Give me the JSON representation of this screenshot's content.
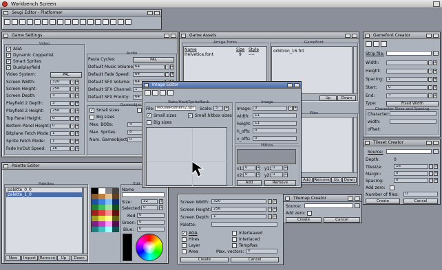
{
  "screen": {
    "title": "Workbench Screen"
  },
  "sevgi": {
    "title": "Sevgi Editor - Platformer"
  },
  "game_settings": {
    "title": "Game Settings",
    "video_group": "Video",
    "audio_group": "Audio",
    "gameobject_group": "Gameobject",
    "aga": "AGA",
    "dynamic_copperlist": "Dynamic Copperlist",
    "smart_sprites": "Smart Sprites",
    "dualplayfield": "Dualplayfield",
    "video_system_label": "Video System:",
    "video_system": "PAL",
    "screen_width_label": "Screen Width:",
    "screen_width": "320",
    "screen_height_label": "Screen Height:",
    "screen_height": "256",
    "screen_depth_label": "Screen Depth:",
    "screen_depth": "3",
    "pf2_depth_label": "Playfield 2 Depth:",
    "pf2_depth": "3",
    "pf2_height_label": "Playfield 2 Height:",
    "pf2_height": "256",
    "top_panel_label": "Top Panel Height:",
    "top_panel": "0",
    "bottom_panel_label": "Bottom Panel Height:",
    "bottom_panel": "0",
    "bitplane_label": "Bitplane Fetch Mode:",
    "bitplane": "1",
    "sprite_fetch_label": "Sprite Fetch Mode:",
    "sprite_fetch": "1",
    "fade_label": "Fade In/Out Speed:",
    "fade": "16",
    "paula_label": "Paula Cycles:",
    "paula": "PAL",
    "music_vol_label": "Default Music Volume:",
    "music_vol": "64",
    "fade_speed_label": "Default Fade Speed:",
    "fade_speed": "64",
    "sfx_vol_label": "Default SFX Volume:",
    "sfx_vol": "64",
    "sfx_chan_label": "Default SFX Channel:",
    "sfx_chan": "1",
    "sfx_prio_label": "Default SFX Priority:",
    "sfx_prio": "64",
    "small_sizes": "Small sizes",
    "big_sizes": "Big sizes",
    "sm": "Sm",
    "max_bobs_label": "Max. BOBs:",
    "max_bobs": "4",
    "max_sprites_label": "Max. Sprites:",
    "max_sprites": "8",
    "num_go_label": "Num. Gameobjects:",
    "num_go": "0"
  },
  "game_assets": {
    "title": "Game Assets",
    "amiga_fonts": "Amiga Fonts",
    "gamefonts": "GameFont",
    "name_col": "Name",
    "size_col": "Size",
    "style_col": "Style",
    "font_name": "Helvetica.font",
    "font_size": "9",
    "font_style": "----",
    "gamefont_item": "orbitron_16.fnt",
    "files": "Files",
    "add": "Add",
    "remove": "Remove",
    "up": "Up",
    "down": "Down"
  },
  "image_editor": {
    "title": "Image Editor",
    "bobs_group": "Bobs/Hwd/SpriteBank",
    "file_label": "File:",
    "file": "MousePointers2.spr",
    "scale_label": "Scale:",
    "scale": "5",
    "small_sizes": "Small sizes",
    "small_hitbox": "Small hitbox sizes",
    "big_sizes": "Big sizes",
    "image_group": "Image",
    "image_label": "Image:",
    "image": "0",
    "width_label": "width:",
    "width": "11",
    "height_label": "height:",
    "height": "11",
    "hoffs_label": "h_offs:",
    "hoffs": "0",
    "voffs_label": "v_offs:",
    "voffs": "0",
    "hitbox_group": "Hitbox",
    "x1_label": "x1:",
    "x1": "0",
    "y1_label": "y1:",
    "y1": "0",
    "x2_label": "x2:",
    "x2": "0",
    "y2_label": "y2:",
    "y2": "0",
    "add": "Add",
    "remove": "Remove"
  },
  "gamefont_creator": {
    "title": "Gamefont Creator",
    "strip_label": "Strip file:",
    "width_label": "Width:",
    "height_label": "Height:",
    "spacing_label": "Spacing:",
    "spacing": "1",
    "start_label": "Start:",
    "start": "0",
    "end_label": "End:",
    "end": "~",
    "type_label": "Type:",
    "type": "Fixed Width",
    "char_group": "Character Sizes and Spacing",
    "character_label": "Character:",
    "width2_label": "width:",
    "offset_label": "offset:"
  },
  "tileset_creator": {
    "title": "Tileset Creator",
    "source_label": "Source:",
    "depth_label": "Depth:",
    "depth": "0",
    "tilesize_label": "Tilesize:",
    "tilesize": "16",
    "margin_label": "Margin:",
    "margin": "0",
    "spacing_label": "Spacing:",
    "spacing": "0",
    "addzero_label": "Add zero:",
    "numfiles_label": "Number of files:",
    "numfiles": "0",
    "create": "Create",
    "cancel": "Cancel"
  },
  "palette_editor": {
    "title": "Palette Editor",
    "palettes_group": "Palettes",
    "edit_group": "Edit Palette",
    "items": [
      "palette_0_0",
      "palette_1_0"
    ],
    "new": "New",
    "import": "Import",
    "remove": "Remove",
    "up": "Up",
    "down": "Down",
    "name_label": "Name",
    "size_label": "Size:",
    "size": "32",
    "selected_label": "Selected:",
    "selected": "0",
    "red_label": "Red:",
    "red": "0",
    "green_label": "Green:",
    "green": "0",
    "blue_label": "Blue:",
    "blue": "0"
  },
  "screen_creator": {
    "screen_width_label": "Screen Width:",
    "screen_width": "320",
    "screen_height_label": "Screen Height:",
    "screen_height": "256",
    "screen_depth_label": "Screen Depth:",
    "screen_depth": "1",
    "palette_label": "Palette:",
    "aga": "AGA",
    "hires": "Hires",
    "layer": "Layer",
    "area": "Area",
    "interleaved": "Interleaved",
    "interlaced": "Interlaced",
    "tempras": "TempRas",
    "max_vectors_label": "Max. vectors:",
    "max_vectors": "0",
    "create": "Create",
    "cancel": "Cancel"
  },
  "tilemap_creator": {
    "title": "Tilemap Creator",
    "source_label": "Source:",
    "addzero_label": "Add zero:",
    "create": "Create",
    "cancel": "Cancel"
  },
  "colors": {
    "titlebar_active": "#4a6ca8",
    "window_bg": "#adb3bd",
    "desktop": "#8a8f99"
  }
}
